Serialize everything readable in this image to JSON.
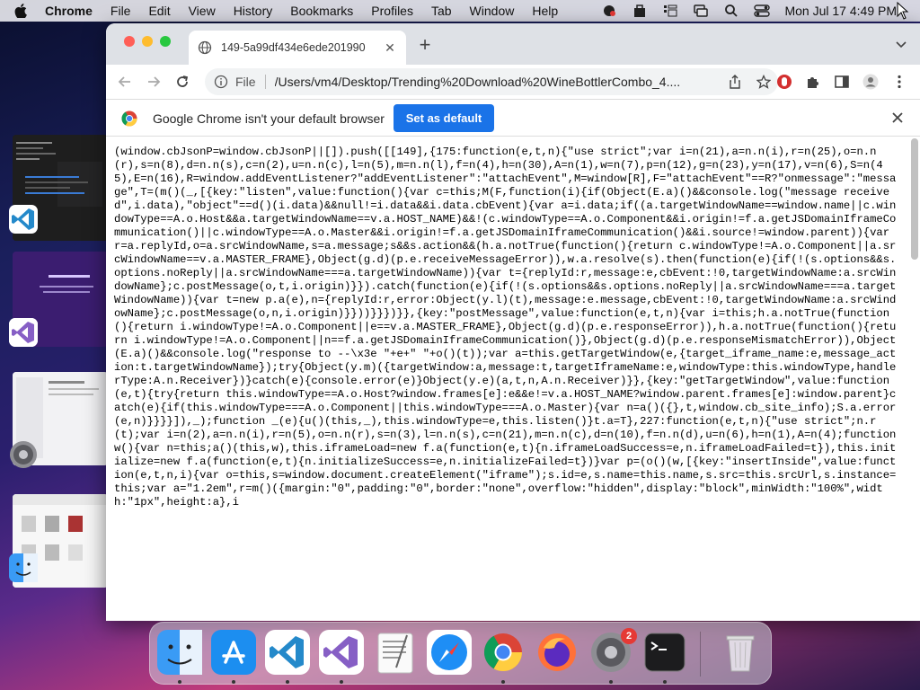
{
  "menubar": {
    "app_name": "Chrome",
    "items": [
      "File",
      "Edit",
      "View",
      "History",
      "Bookmarks",
      "Profiles",
      "Tab",
      "Window",
      "Help"
    ],
    "clock": "Mon Jul 17  4:49 PM"
  },
  "browser": {
    "tab_title": "149-5a99df434e6ede201990",
    "url_scheme_label": "File",
    "url": "/Users/vm4/Desktop/Trending%20Download%20WineBottlerCombo_4....",
    "infobar_message": "Google Chrome isn't your default browser",
    "set_default_label": "Set as default"
  },
  "content": {
    "code": "(window.cbJsonP=window.cbJsonP||[]).push([[149],{175:function(e,t,n){\"use strict\";var i=n(21),a=n.n(i),r=n(25),o=n.n(r),s=n(8),d=n.n(s),c=n(2),u=n.n(c),l=n(5),m=n.n(l),f=n(4),h=n(30),A=n(1),w=n(7),p=n(12),g=n(23),y=n(17),v=n(6),S=n(45),E=n(16),R=window.addEventListener?\"addEventListener\":\"attachEvent\",M=window[R],F=\"attachEvent\"==R?\"onmessage\":\"message\",T=(m()(_,[{key:\"listen\",value:function(){var c=this;M(F,function(i){if(Object(E.a)()&&console.log(\"message received\",i.data),\"object\"==d()(i.data)&&null!=i.data&&i.data.cbEvent){var a=i.data;if((a.targetWindowName==window.name||c.windowType==A.o.Host&&a.targetWindowName==v.a.HOST_NAME)&&!(c.windowType==A.o.Component&&i.origin!=f.a.getJSDomainIframeCommunication()||c.windowType==A.o.Master&&i.origin!=f.a.getJSDomainIframeCommunication()&&i.source!=window.parent)){var r=a.replyId,o=a.srcWindowName,s=a.message;s&&s.action&&(h.a.notTrue(function(){return c.windowType!=A.o.Component||a.srcWindowName==v.a.MASTER_FRAME},Object(g.d)(p.e.receiveMessageError)),w.a.resolve(s).then(function(e){if(!(s.options&&s.options.noReply||a.srcWindowName===a.targetWindowName)){var t={replyId:r,message:e,cbEvent:!0,targetWindowName:a.srcWindowName};c.postMessage(o,t,i.origin)}}).catch(function(e){if(!(s.options&&s.options.noReply||a.srcWindowName===a.targetWindowName)){var t=new p.a(e),n={replyId:r,error:Object(y.l)(t),message:e.message,cbEvent:!0,targetWindowName:a.srcWindowName};c.postMessage(o,n,i.origin)}}))}}})}},{key:\"postMessage\",value:function(e,t,n){var i=this;h.a.notTrue(function(){return i.windowType!=A.o.Component||e==v.a.MASTER_FRAME},Object(g.d)(p.e.responseError)),h.a.notTrue(function(){return i.windowType!=A.o.Component||n==f.a.getJSDomainIframeCommunication()},Object(g.d)(p.e.responseMismatchError)),Object(E.a)()&&console.log(\"response to --\\x3e \"+e+\" \"+o()(t));var a=this.getTargetWindow(e,{target_iframe_name:e,message_action:t.targetWindowName});try{Object(y.m)({targetWindow:a,message:t,targetIframeName:e,windowType:this.windowType,handlerType:A.n.Receiver})}catch(e){console.error(e)}Object(y.e)(a,t,n,A.n.Receiver)}},{key:\"getTargetWindow\",value:function(e,t){try{return this.windowType==A.o.Host?window.frames[e]:e&&e!=v.a.HOST_NAME?window.parent.frames[e]:window.parent}catch(e){if(this.windowType===A.o.Component||this.windowType===A.o.Master){var n=a()({},t,window.cb_site_info);S.a.error(e,n)}}}}]),_);function _(e){u()(this,_),this.windowType=e,this.listen()}t.a=T},227:function(e,t,n){\"use strict\";n.r(t);var i=n(2),a=n.n(i),r=n(5),o=n.n(r),s=n(3),l=n.n(s),c=n(21),m=n.n(c),d=n(10),f=n.n(d),u=n(6),h=n(1),A=n(4);function w(){var n=this;a()(this,w),this.iframeLoad=new f.a(function(e,t){n.iframeLoadSuccess=e,n.iframeLoadFailed=t}),this.initialize=new f.a(function(e,t){n.initializeSuccess=e,n.initializeFailed=t})}var p=(o()(w,[{key:\"insertInside\",value:function(e,t,n,i){var o=this,s=window.document.createElement(\"iframe\");s.id=e,s.name=this.name,s.src=this.srcUrl,s.instance=this;var a=\"1.2em\",r=m()({margin:\"0\",padding:\"0\",border:\"none\",overflow:\"hidden\",display:\"block\",minWidth:\"100%\",width:\"1px\",height:a},i"
  },
  "dock": {
    "settings_badge": "2"
  }
}
